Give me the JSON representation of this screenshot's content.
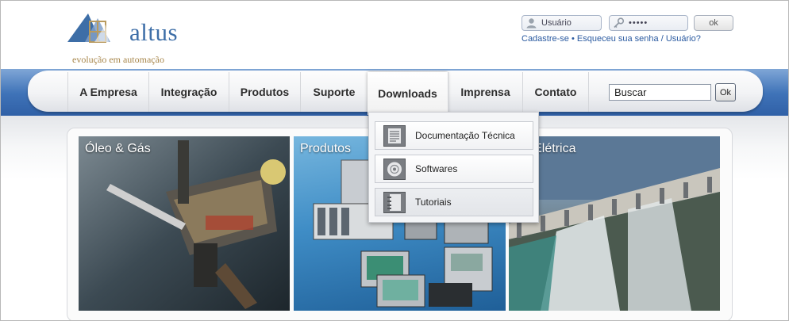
{
  "header": {
    "logo_text": "altus",
    "logo_tagline": "evolução em automação",
    "brand_colors": {
      "logo_blue": "#3d6ea7",
      "tagline_gold": "#a8874c"
    }
  },
  "login": {
    "user_placeholder": "Usuário",
    "password_mask": "•••••",
    "ok_label": "ok",
    "link_register": "Cadastre-se",
    "bullet": "•",
    "link_forgot_password": "Esqueceu sua senha",
    "slash": "/",
    "link_forgot_user": "Usuário?",
    "icons": {
      "user": "user-icon",
      "password": "key-icon"
    }
  },
  "nav": {
    "items": [
      {
        "label": "A Empresa",
        "active": false
      },
      {
        "label": "Integração",
        "active": false
      },
      {
        "label": "Produtos",
        "active": false
      },
      {
        "label": "Suporte",
        "active": false
      },
      {
        "label": "Downloads",
        "active": true
      },
      {
        "label": "Imprensa",
        "active": false
      },
      {
        "label": "Contato",
        "active": false
      }
    ],
    "search_value": "Buscar",
    "search_button": "Ok",
    "band_color": "#3f73b8"
  },
  "dropdown": {
    "items": [
      {
        "label": "Documentação Técnica",
        "icon": "document-icon"
      },
      {
        "label": "Softwares",
        "icon": "cd-disc-icon"
      },
      {
        "label": "Tutoriais",
        "icon": "notebook-icon"
      }
    ]
  },
  "tiles": [
    {
      "label": "Óleo & Gás",
      "image": "offshore-oil-platform"
    },
    {
      "label": "Produtos",
      "image": "automation-products"
    },
    {
      "label": "rgia Elétrica",
      "image": "hydroelectric-dam"
    }
  ]
}
